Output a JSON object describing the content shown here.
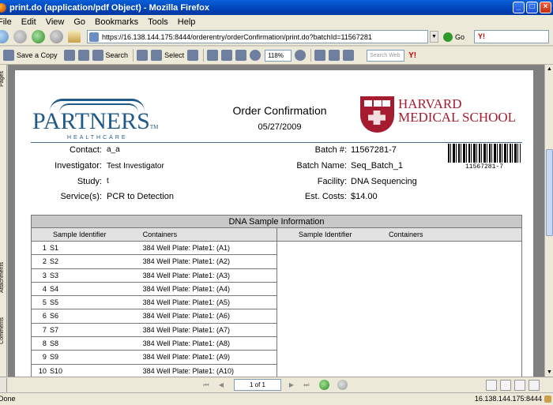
{
  "window": {
    "title": "print.do (application/pdf Object) - Mozilla Firefox",
    "minimize": "_",
    "maximize": "□",
    "close": "×"
  },
  "menu": [
    "File",
    "Edit",
    "View",
    "Go",
    "Bookmarks",
    "Tools",
    "Help"
  ],
  "nav": {
    "url": "https://16.138.144.175:8444/orderentry/orderConfirmation/print.do?batchId=11567281",
    "go_label": "Go",
    "search_engine": "Y!"
  },
  "pdf_toolbar": {
    "save_copy": "Save a Copy",
    "search": "Search",
    "select": "Select",
    "zoom": "118%",
    "search_web_placeholder": "Search Web",
    "yahoo": "Y!"
  },
  "sidebar_tabs": [
    "Pages",
    "Attachments",
    "Comments"
  ],
  "document": {
    "logo_left": {
      "name": "PARTNERS",
      "tm": "TM",
      "sub": "HEALTHCARE"
    },
    "title": "Order Confirmation",
    "date": "05/27/2009",
    "logo_right": {
      "line1": "HARVARD",
      "line2": "MEDICAL SCHOOL"
    },
    "fields_left": [
      {
        "label": "Contact:",
        "value": "a_a"
      },
      {
        "label": "Investigator:",
        "value": "Test Investigator"
      },
      {
        "label": "Study:",
        "value": "t"
      },
      {
        "label": "Service(s):",
        "value": "PCR to Detection"
      }
    ],
    "fields_right": [
      {
        "label": "Batch #:",
        "value": "11567281-7"
      },
      {
        "label": "Batch Name:",
        "value": "Seq_Batch_1"
      },
      {
        "label": "Facility:",
        "value": "DNA Sequencing"
      },
      {
        "label": "Est. Costs:",
        "value": "$14.00"
      }
    ],
    "barcode_text": "11567281-7",
    "table": {
      "title": "DNA Sample Information",
      "headers": [
        "Sample Identifier",
        "Containers",
        "Sample Identifier",
        "Containers"
      ],
      "rows": [
        {
          "num": "1",
          "id": "S1",
          "container": "384 Well Plate: Plate1: (A1)"
        },
        {
          "num": "2",
          "id": "S2",
          "container": "384 Well Plate: Plate1: (A2)"
        },
        {
          "num": "3",
          "id": "S3",
          "container": "384 Well Plate: Plate1: (A3)"
        },
        {
          "num": "4",
          "id": "S4",
          "container": "384 Well Plate: Plate1: (A4)"
        },
        {
          "num": "5",
          "id": "S5",
          "container": "384 Well Plate: Plate1: (A5)"
        },
        {
          "num": "6",
          "id": "S6",
          "container": "384 Well Plate: Plate1: (A6)"
        },
        {
          "num": "7",
          "id": "S7",
          "container": "384 Well Plate: Plate1: (A7)"
        },
        {
          "num": "8",
          "id": "S8",
          "container": "384 Well Plate: Plate1: (A8)"
        },
        {
          "num": "9",
          "id": "S9",
          "container": "384 Well Plate: Plate1: (A9)"
        },
        {
          "num": "10",
          "id": "S10",
          "container": "384 Well Plate: Plate1: (A10)"
        }
      ]
    }
  },
  "pdf_nav": {
    "page_indicator": "1 of 1"
  },
  "status": {
    "text": "Done",
    "host": "16.138.144.175:8444"
  },
  "colors": {
    "titlebar": "#0044b8",
    "partners_blue": "#1f5a8a",
    "harvard_crimson": "#a51c30"
  }
}
